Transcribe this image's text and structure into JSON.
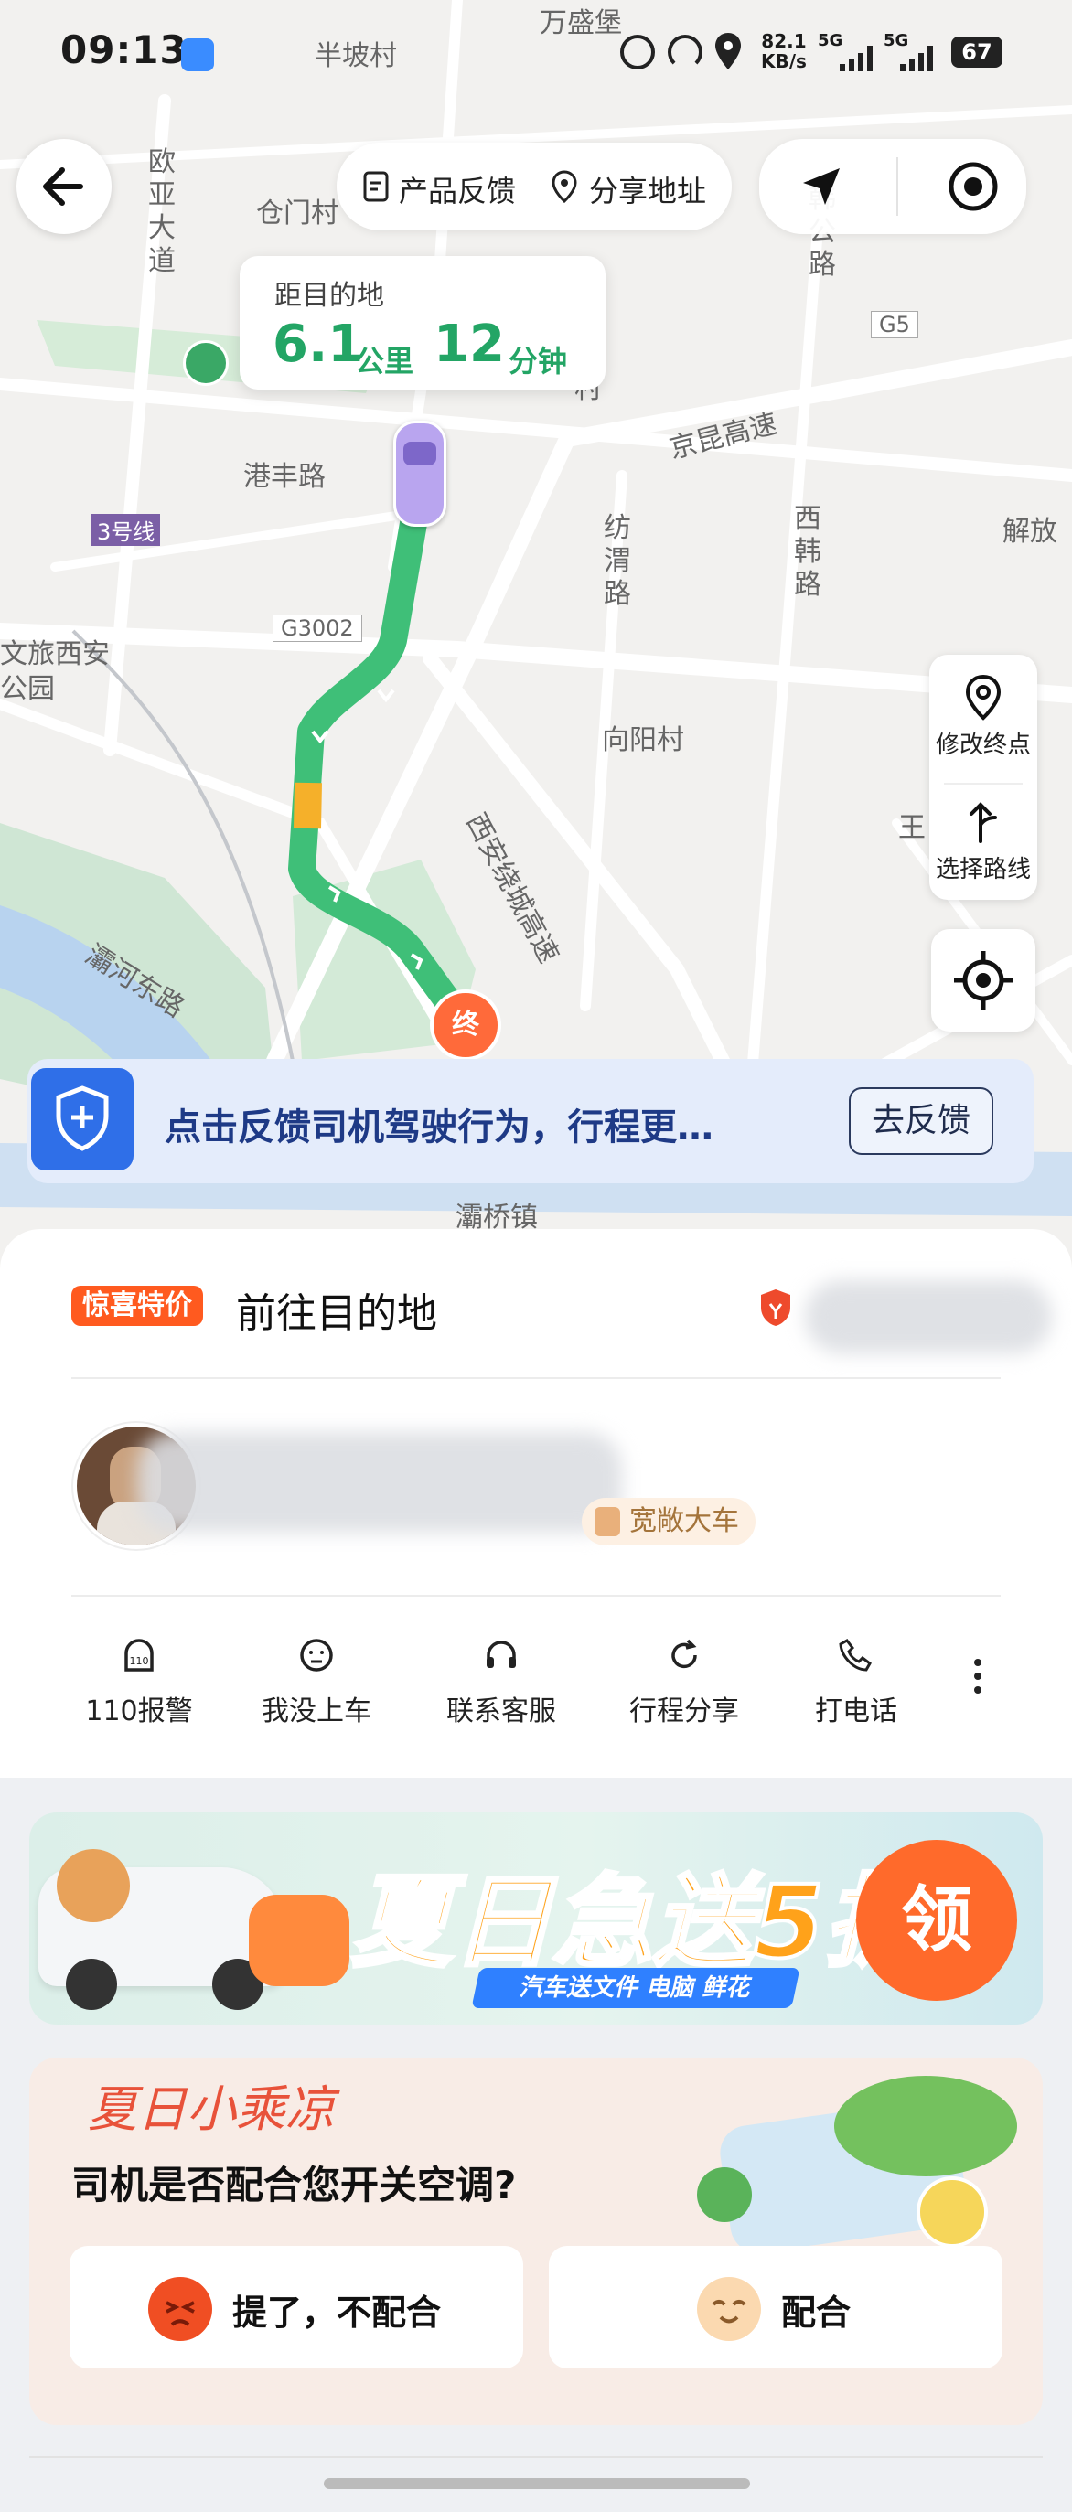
{
  "status_bar": {
    "time": "09:13",
    "net_speed": "82.1",
    "net_unit": "KB/s",
    "signal1": "5G",
    "signal2": "5G",
    "battery": "67"
  },
  "map": {
    "labels": [
      "半坡村",
      "万盛堡",
      "仓门村",
      "港丰路",
      "3号线",
      "G3002",
      "文旅西安",
      "公园",
      "京昆高速",
      "纺渭路",
      "西韩路",
      "解放",
      "向阳村",
      "西安绕城高速",
      "灞河东路",
      "灞桥镇",
      "G5",
      "王",
      "欧亚大道",
      "韩公路",
      "村"
    ],
    "buttons": {
      "product_feedback": "产品反馈",
      "share_address": "分享地址",
      "modify_destination": "修改终点",
      "select_route": "选择路线"
    },
    "trip": {
      "label": "距目的地",
      "distance_value": "6.1",
      "distance_unit": "公里",
      "time_value": "12",
      "time_unit": "分钟"
    },
    "end_marker": "终"
  },
  "feedback_banner": {
    "text": "点击反馈司机驾驶行为，行程更…",
    "button": "去反馈"
  },
  "driver_card": {
    "promo_tag": "惊喜特价",
    "title": "前往目的地",
    "car_tag": "宽敞大车",
    "actions": [
      "110报警",
      "我没上车",
      "联系客服",
      "行程分享",
      "打电话"
    ]
  },
  "ad_banner": {
    "title": "夏日急送5折",
    "title_suffix": "起",
    "subtitle": "汽车送文件 电脑 鲜花",
    "cta": "领"
  },
  "survey": {
    "brand": "夏日小乘凉",
    "question": "司机是否配合您开关空调?",
    "option_no": "提了，不配合",
    "option_yes": "配合"
  },
  "colors": {
    "route_green": "#3fbf78",
    "accent_orange": "#ff5a1f",
    "trip_green": "#23a565",
    "feedback_blue": "#2f6fe8"
  }
}
